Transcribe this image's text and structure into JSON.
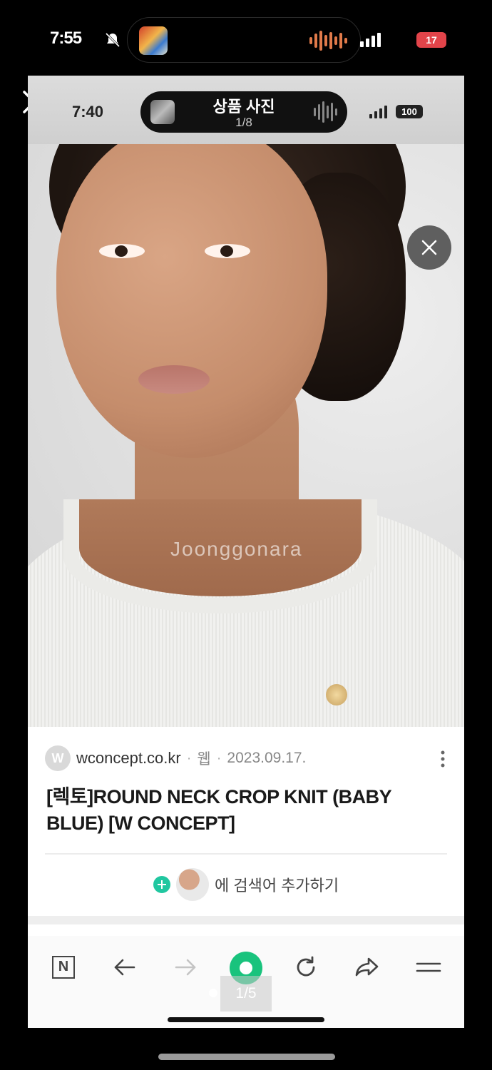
{
  "outer_status": {
    "time": "7:55",
    "battery": "17"
  },
  "inner_status": {
    "time": "7:40",
    "island_title": "상품 사진",
    "island_counter": "1/8",
    "battery": "100"
  },
  "photo": {
    "watermark": "Joonggonara"
  },
  "result": {
    "favicon_letter": "W",
    "site": "wconcept.co.kr",
    "type": "웹",
    "date": "2023.09.17.",
    "title": "[렉토]ROUND NECK CROP KNIT (BABY BLUE) [W CONCEPT]",
    "add_search_label": "에 검색어 추가하기"
  },
  "toolbar": {
    "page_indicator": "1/5",
    "home_letter": "N"
  },
  "colors": {
    "accent_green": "#19c37d",
    "plus_teal": "#20c7a0",
    "battery_red": "#e2444a"
  }
}
